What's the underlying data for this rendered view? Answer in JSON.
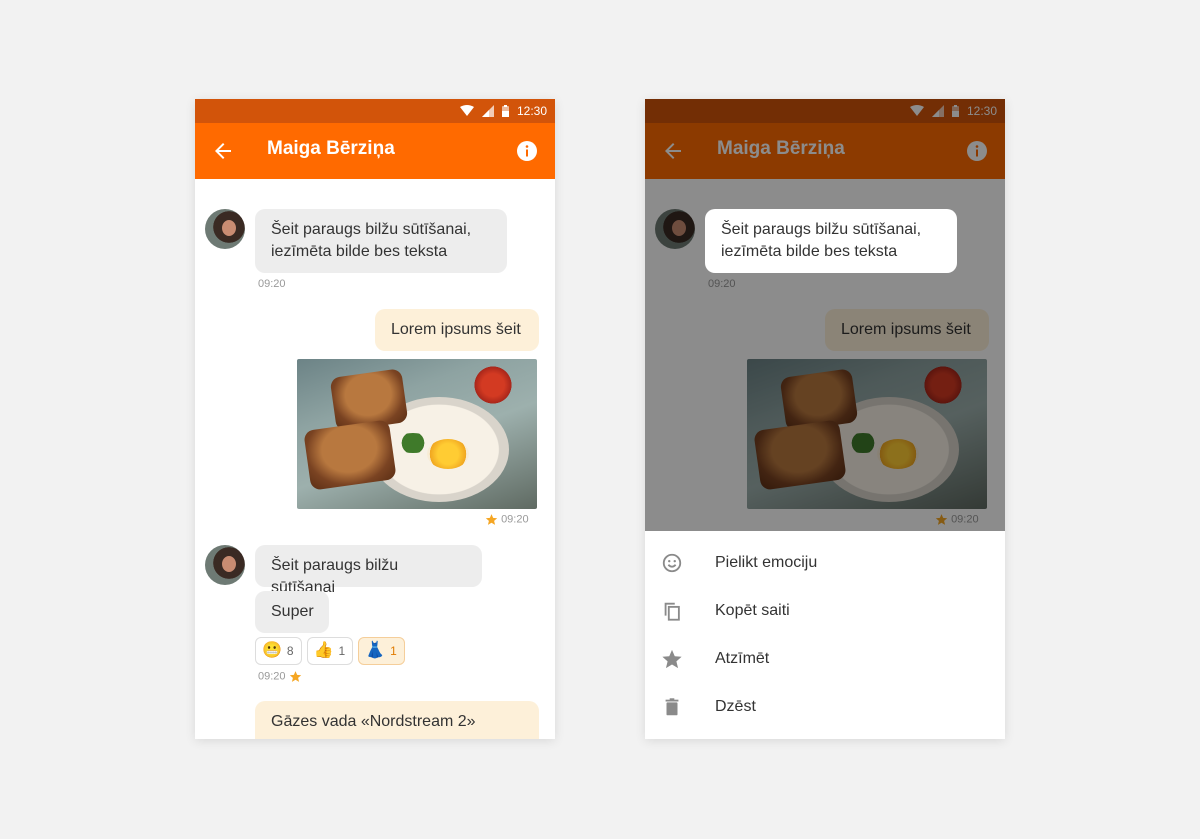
{
  "status": {
    "time": "12:30"
  },
  "header": {
    "title": "Maiga Bērziņa"
  },
  "messages": {
    "m1": {
      "text": "Šeit paraugs bilžu sūtīšanai, iezīmēta bilde bes teksta",
      "time": "09:20"
    },
    "m2": {
      "text": "Lorem ipsums šeit"
    },
    "m3": {
      "time": "09:20"
    },
    "m4": {
      "text": "Šeit paraugs bilžu sūtīšanai"
    },
    "m5": {
      "text": "Super",
      "time": "09:20"
    },
    "m6": {
      "text": "Gāzes vada «Nordstream 2»"
    }
  },
  "reactions": [
    {
      "emoji": "😬",
      "count": "8"
    },
    {
      "emoji": "👍",
      "count": "1"
    },
    {
      "emoji": "👗",
      "count": "1"
    }
  ],
  "menu": {
    "items": [
      {
        "label": "Pielikt emociju",
        "icon": "emoji-icon"
      },
      {
        "label": "Kopēt saiti",
        "icon": "copy-icon"
      },
      {
        "label": "Atzīmēt",
        "icon": "star-icon"
      },
      {
        "label": "Dzēst",
        "icon": "trash-icon"
      }
    ]
  },
  "colors": {
    "accent": "#ff6a00",
    "statusbar": "#d2540a",
    "incoming": "#ededed",
    "outgoing": "#fdf0d9",
    "star": "#f5a623"
  }
}
